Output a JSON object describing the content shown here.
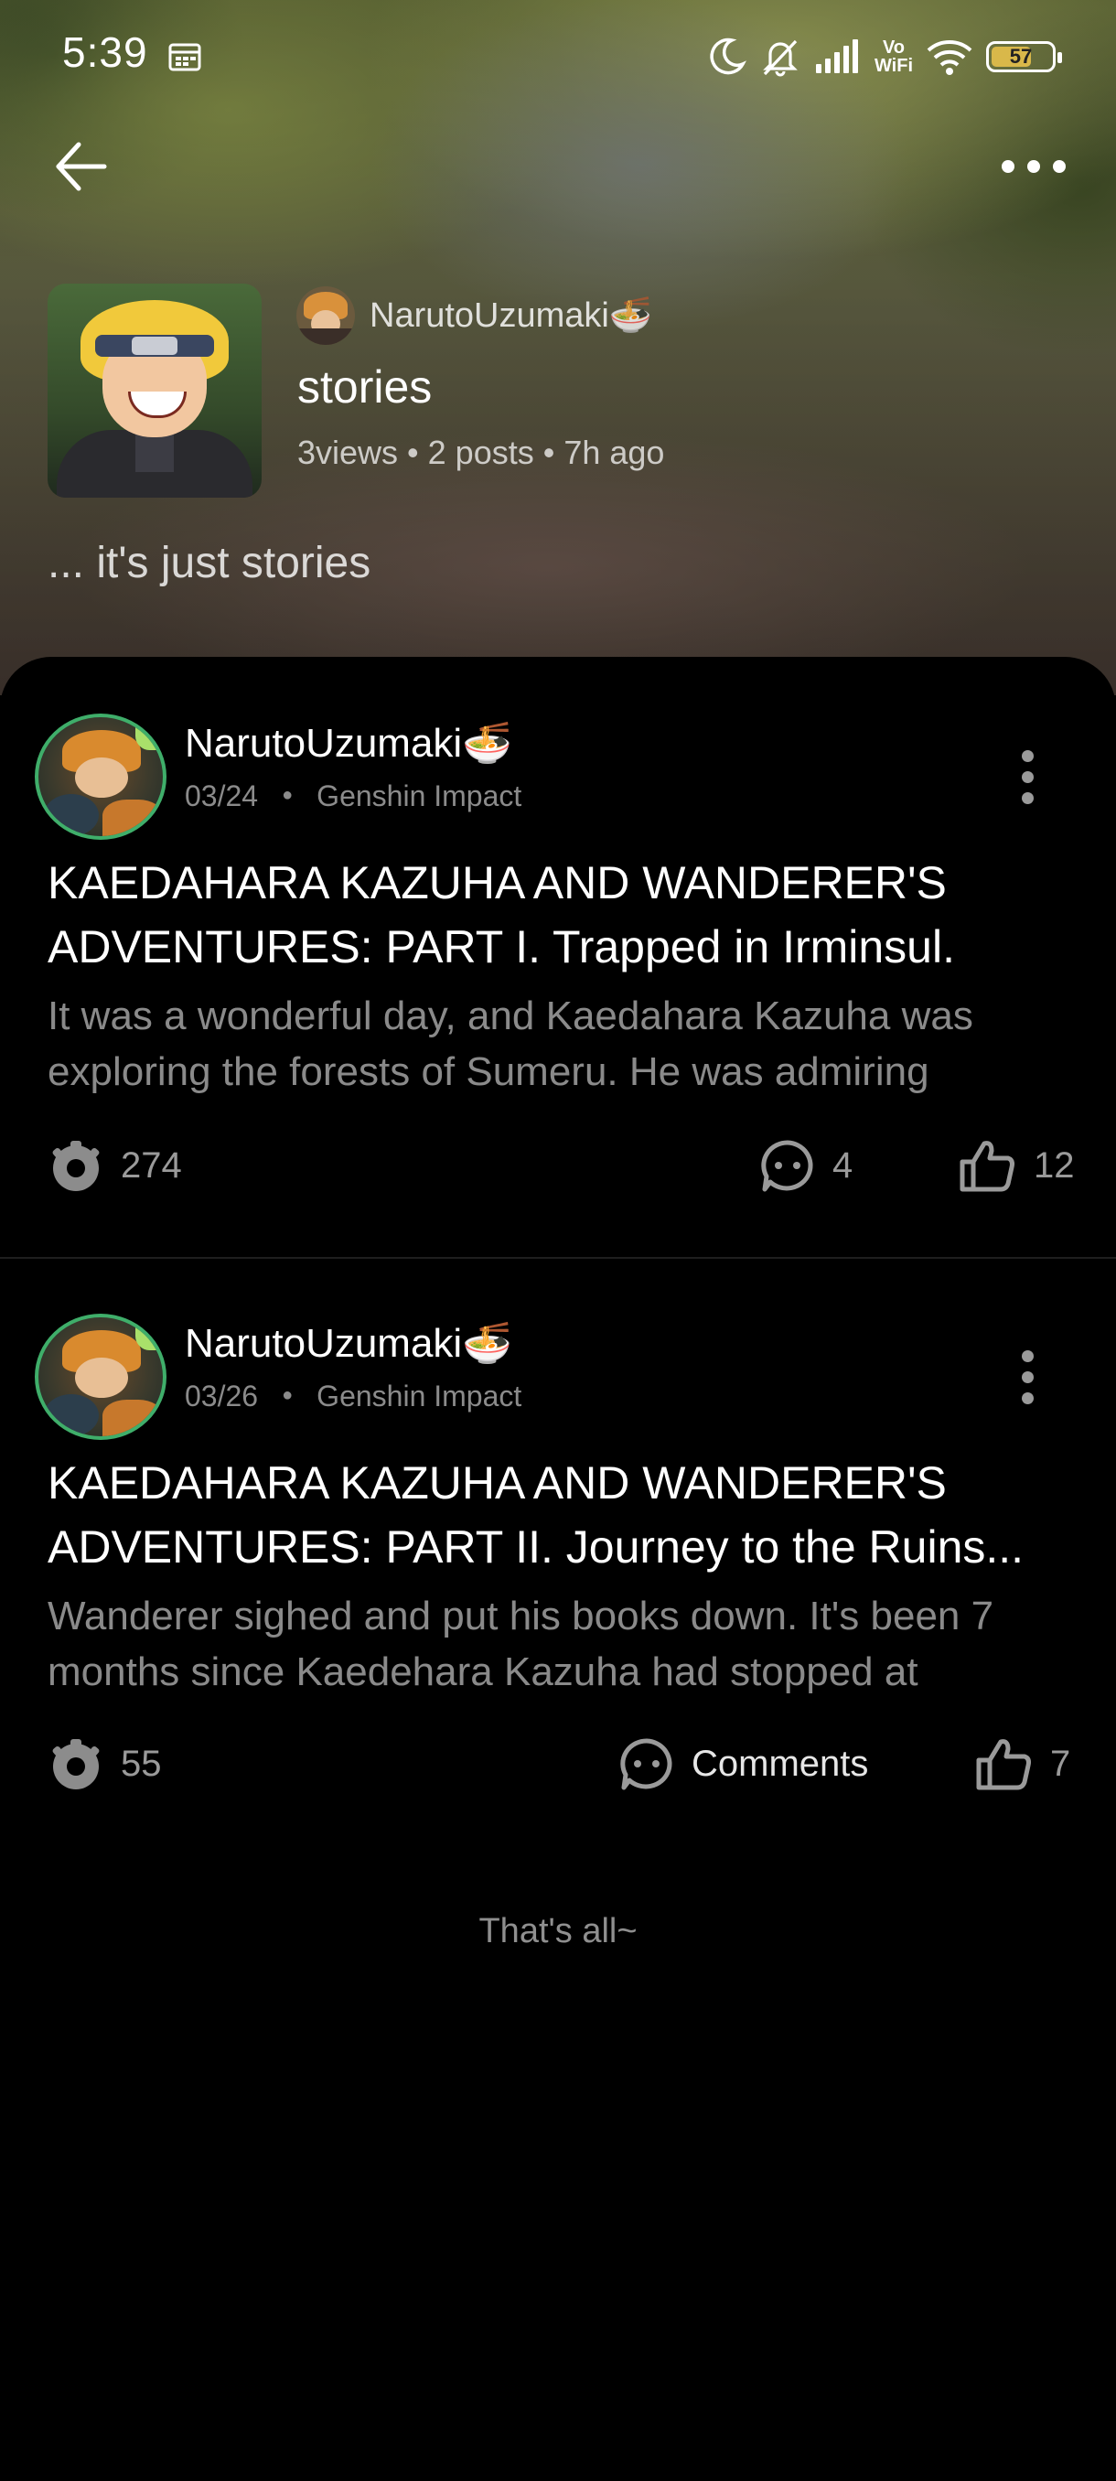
{
  "status_bar": {
    "time": "5:39",
    "battery": "57",
    "vowifi_top": "Vo",
    "vowifi_bottom": "WiFi"
  },
  "collection": {
    "author": "NarutoUzumaki🍜",
    "title": "stories",
    "meta": "3views • 2 posts • 7h ago",
    "description": "... it's just stories"
  },
  "posts": [
    {
      "author": "NarutoUzumaki🍜",
      "date": "03/24",
      "category": "Genshin Impact",
      "title_line1": "KAEDAHARA KAZUHA AND WANDERER'S",
      "title_line2": "ADVENTURES: PART I. Trapped in Irminsul.",
      "excerpt_line1": "It was a wonderful day, and Kaedahara Kazuha was",
      "excerpt_line2": "exploring the forests of Sumeru. He was admiring",
      "views": "274",
      "comments": "4",
      "likes": "12"
    },
    {
      "author": "NarutoUzumaki🍜",
      "date": "03/26",
      "category": "Genshin Impact",
      "title_line1": "KAEDAHARA KAZUHA AND WANDERER'S",
      "title_line2": "ADVENTURES: PART II. Journey to the Ruins...",
      "excerpt_line1": "Wanderer sighed and put his books down. It's been 7",
      "excerpt_line2": "months since Kaedehara Kazuha had stopped at",
      "views": "55",
      "comments": "Comments",
      "likes": "7"
    }
  ],
  "footer_text": "That's all~",
  "icons": {
    "back": "arrow-left-icon",
    "more": "more-horizontal-icon",
    "post_menu": "more-vertical-icon",
    "views": "eye-icon",
    "comments": "comment-bubble-icon",
    "likes": "thumbs-up-icon"
  }
}
